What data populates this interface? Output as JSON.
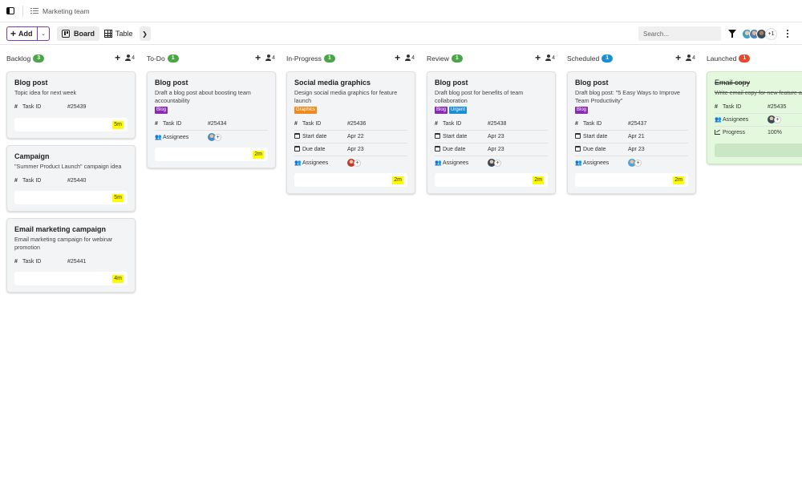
{
  "titlebar": {
    "title": "Marketing team"
  },
  "toolbar": {
    "add_label": "Add",
    "views": [
      {
        "label": "Board",
        "active": true
      },
      {
        "label": "Table",
        "active": false
      }
    ],
    "search_placeholder": "Search...",
    "extra_members": "+1"
  },
  "columns": [
    {
      "title": "Backlog",
      "count": "3",
      "badge_color": "#4aa546",
      "people": "4",
      "cards": [
        {
          "title": "Blog post",
          "desc": "Topic idea for next week",
          "tags": [],
          "fields": [
            {
              "type": "id",
              "label": "Task ID",
              "value": "#25439"
            }
          ],
          "time": "5m"
        },
        {
          "title": "Campaign",
          "desc": "\"Summer Product Launch\" campaign idea",
          "tags": [],
          "fields": [
            {
              "type": "id",
              "label": "Task ID",
              "value": "#25440"
            }
          ],
          "time": "5m"
        },
        {
          "title": "Email marketing campaign",
          "desc": "Email marketing campaign for webinar promotion",
          "tags": [],
          "fields": [
            {
              "type": "id",
              "label": "Task ID",
              "value": "#25441"
            }
          ],
          "time": "4m"
        }
      ]
    },
    {
      "title": "To-Do",
      "count": "1",
      "badge_color": "#4aa546",
      "people": "4",
      "cards": [
        {
          "title": "Blog post",
          "desc": "Draft a blog post about boosting team accountability",
          "tags": [
            {
              "label": "Blog",
              "color": "#8a2bb5"
            }
          ],
          "fields": [
            {
              "type": "id",
              "label": "Task ID",
              "value": "#25434"
            },
            {
              "type": "assignees",
              "label": "Assignees",
              "avatar": "#4a8fc4"
            }
          ],
          "time": "2m"
        }
      ]
    },
    {
      "title": "In-Progress",
      "count": "1",
      "badge_color": "#4aa546",
      "people": "4",
      "cards": [
        {
          "title": "Social media graphics",
          "desc": "Design social media graphics for feature launch",
          "tags": [
            {
              "label": "Graphics",
              "color": "#ef8a1c"
            }
          ],
          "fields": [
            {
              "type": "id",
              "label": "Task ID",
              "value": "#25436"
            },
            {
              "type": "date",
              "label": "Start date",
              "value": "Apr 22"
            },
            {
              "type": "date",
              "label": "Due date",
              "value": "Apr 23"
            },
            {
              "type": "assignees",
              "label": "Assignees",
              "avatar": "#c0392b"
            }
          ],
          "time": "2m"
        }
      ]
    },
    {
      "title": "Review",
      "count": "1",
      "badge_color": "#4aa546",
      "people": "4",
      "cards": [
        {
          "title": "Blog post",
          "desc": "Draft blog post for benefits of team collaboration",
          "tags": [
            {
              "label": "Blog",
              "color": "#8a2bb5"
            },
            {
              "label": "Urgent",
              "color": "#1a8fd6"
            }
          ],
          "fields": [
            {
              "type": "id",
              "label": "Task ID",
              "value": "#25438"
            },
            {
              "type": "date",
              "label": "Start date",
              "value": "Apr 23"
            },
            {
              "type": "date",
              "label": "Due date",
              "value": "Apr 23"
            },
            {
              "type": "assignees",
              "label": "Assignees",
              "avatar": "#3b4a5a"
            }
          ],
          "time": "2m"
        }
      ]
    },
    {
      "title": "Scheduled",
      "count": "1",
      "badge_color": "#1a8fd6",
      "people": "4",
      "cards": [
        {
          "title": "Blog post",
          "desc": "Draft blog post: \"5 Easy Ways to Improve Team Productivity\"",
          "tags": [
            {
              "label": "Blog",
              "color": "#8a2bb5"
            }
          ],
          "fields": [
            {
              "type": "id",
              "label": "Task ID",
              "value": "#25437"
            },
            {
              "type": "date",
              "label": "Start date",
              "value": "Apr 21"
            },
            {
              "type": "date",
              "label": "Due date",
              "value": "Apr 23"
            },
            {
              "type": "assignees",
              "label": "Assignees",
              "avatar": "#5aa0d8"
            }
          ],
          "time": "2m"
        }
      ]
    },
    {
      "title": "Launched",
      "count": "1",
      "badge_color": "#e8472b",
      "people": "",
      "cards": [
        {
          "title": "Email copy",
          "desc": "Write email copy for new feature announcement",
          "done": true,
          "tags": [],
          "fields": [
            {
              "type": "id",
              "label": "Task ID",
              "value": "#25435"
            },
            {
              "type": "assignees",
              "label": "Assignees",
              "avatar": "#3b4a5a"
            },
            {
              "type": "progress",
              "label": "Progress",
              "value": "100%"
            }
          ],
          "time": ""
        }
      ]
    }
  ]
}
